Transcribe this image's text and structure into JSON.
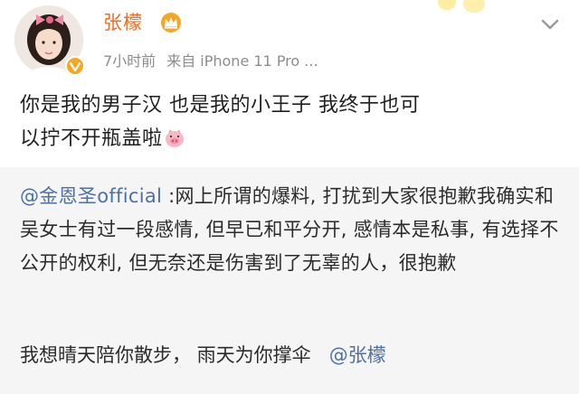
{
  "post": {
    "author": {
      "name": "张檬",
      "vip_color": "#f5a623"
    },
    "meta": {
      "time": "7小时前",
      "source": "来自 iPhone 11 Pro ..."
    },
    "text_line1": "你是我的男子汉  也是我的小王子  我终于也可",
    "text_line2": "以拧不开瓶盖啦",
    "emoji": "pig-face"
  },
  "repost": {
    "mention": "@金恩圣official",
    "body": " :网上所谓的爆料, 打扰到大家很抱歉我确实和吴女士有过一段感情, 但早已和平分开, 感情本是私事, 有选择不公开的权利, 但无奈还是伤害到了无辜的人，很抱歉",
    "extra_text": "我想晴天陪你散步，  雨天为你撑伞",
    "extra_mention": "@张檬"
  },
  "colors": {
    "username": "#f56c1e",
    "mention": "#4b72a8",
    "meta": "#8c8c8c",
    "repost_bg": "#f5f5f5"
  }
}
